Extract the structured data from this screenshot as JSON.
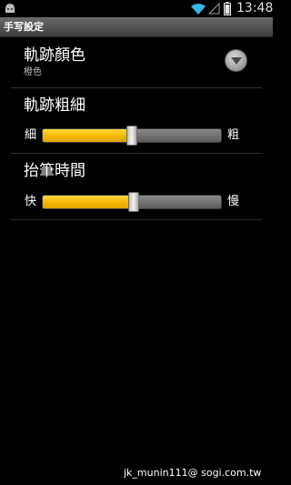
{
  "status_bar": {
    "time": "13:48",
    "icons": [
      "android-icon",
      "wifi-icon",
      "signal-icon",
      "battery-icon"
    ]
  },
  "title_bar": {
    "title": "手写設定"
  },
  "preferences": {
    "track_color": {
      "title": "軌跡顏色",
      "summary": "橙色"
    },
    "track_width": {
      "title": "軌跡粗細",
      "min_label": "細",
      "max_label": "粗",
      "value_percent": 50
    },
    "lift_time": {
      "title": "抬筆時間",
      "min_label": "快",
      "max_label": "慢",
      "value_percent": 51
    }
  },
  "colors": {
    "accent_fill": "#f5b800",
    "background": "#000000"
  },
  "watermark": "jk_munin111@ sogi.com.tw"
}
